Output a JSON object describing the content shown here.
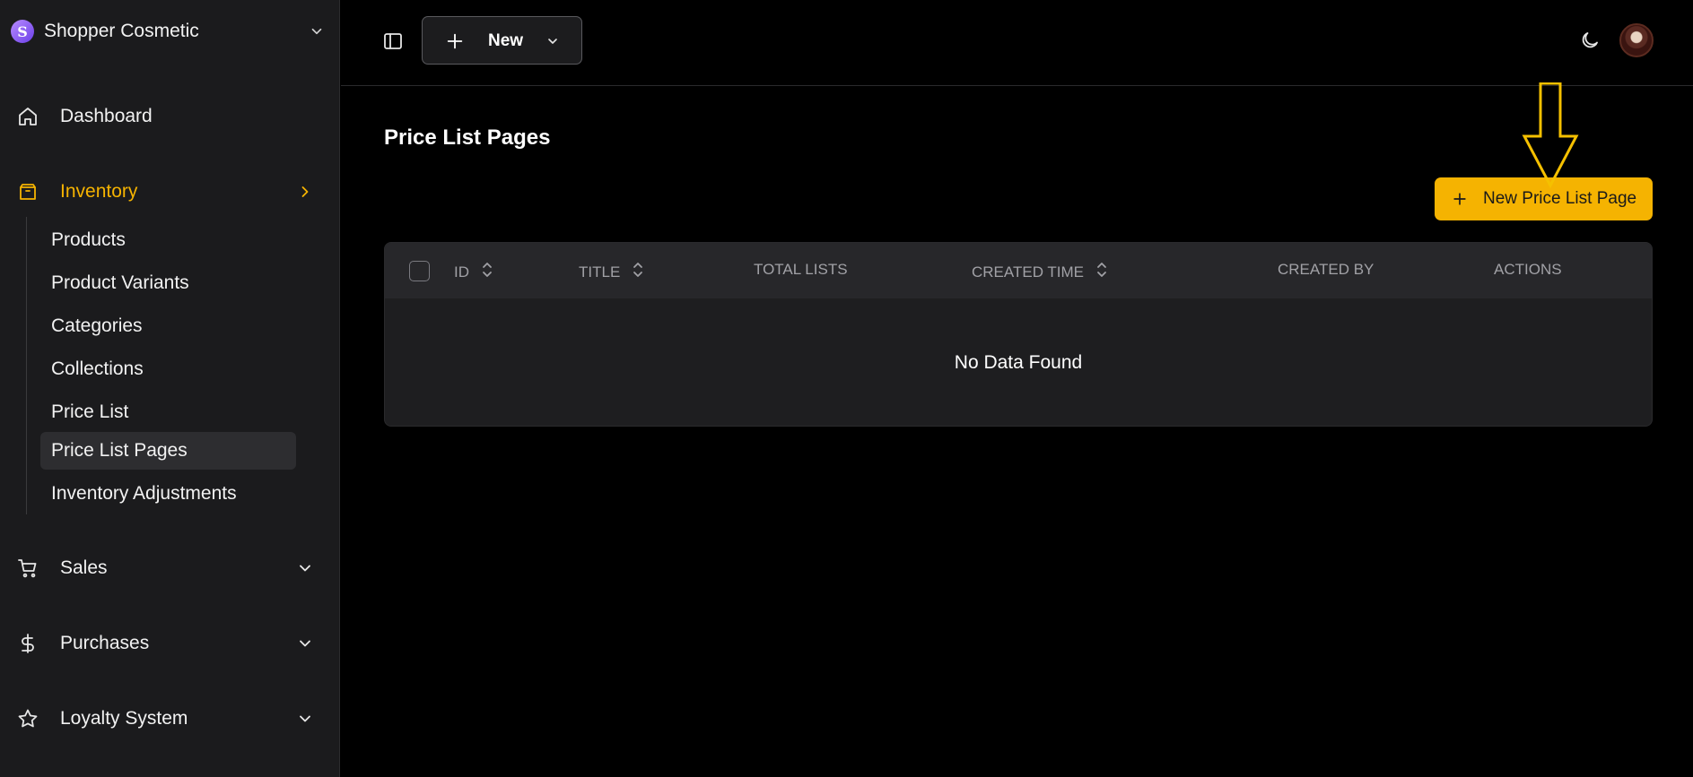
{
  "sidebar": {
    "brand": "Shopper Cosmetic",
    "nav": {
      "dashboard": "Dashboard",
      "inventory": "Inventory",
      "sales": "Sales",
      "purchases": "Purchases",
      "loyalty": "Loyalty System"
    },
    "inventory_items": [
      "Products",
      "Product Variants",
      "Categories",
      "Collections",
      "Price List",
      "Price List Pages",
      "Inventory Adjustments"
    ],
    "selected_item": "Price List Pages"
  },
  "header": {
    "new_button": "New"
  },
  "main": {
    "title": "Price List Pages",
    "primary_action": "New Price List Page",
    "table": {
      "columns": [
        "ID",
        "TITLE",
        "TOTAL LISTS",
        "CREATED TIME",
        "CREATED BY",
        "ACTIONS"
      ],
      "empty_message": "No Data Found"
    }
  },
  "colors": {
    "accent": "#f5b301",
    "sidebar_bg": "#1b1b1d",
    "page_bg": "#000000"
  },
  "icons": [
    "home-icon",
    "package-icon",
    "cart-icon",
    "dollar-icon",
    "star-icon",
    "sidebar-toggle-icon",
    "plus-icon",
    "chevron-down-icon",
    "chevron-right-icon",
    "moon-icon",
    "sort-icon"
  ]
}
